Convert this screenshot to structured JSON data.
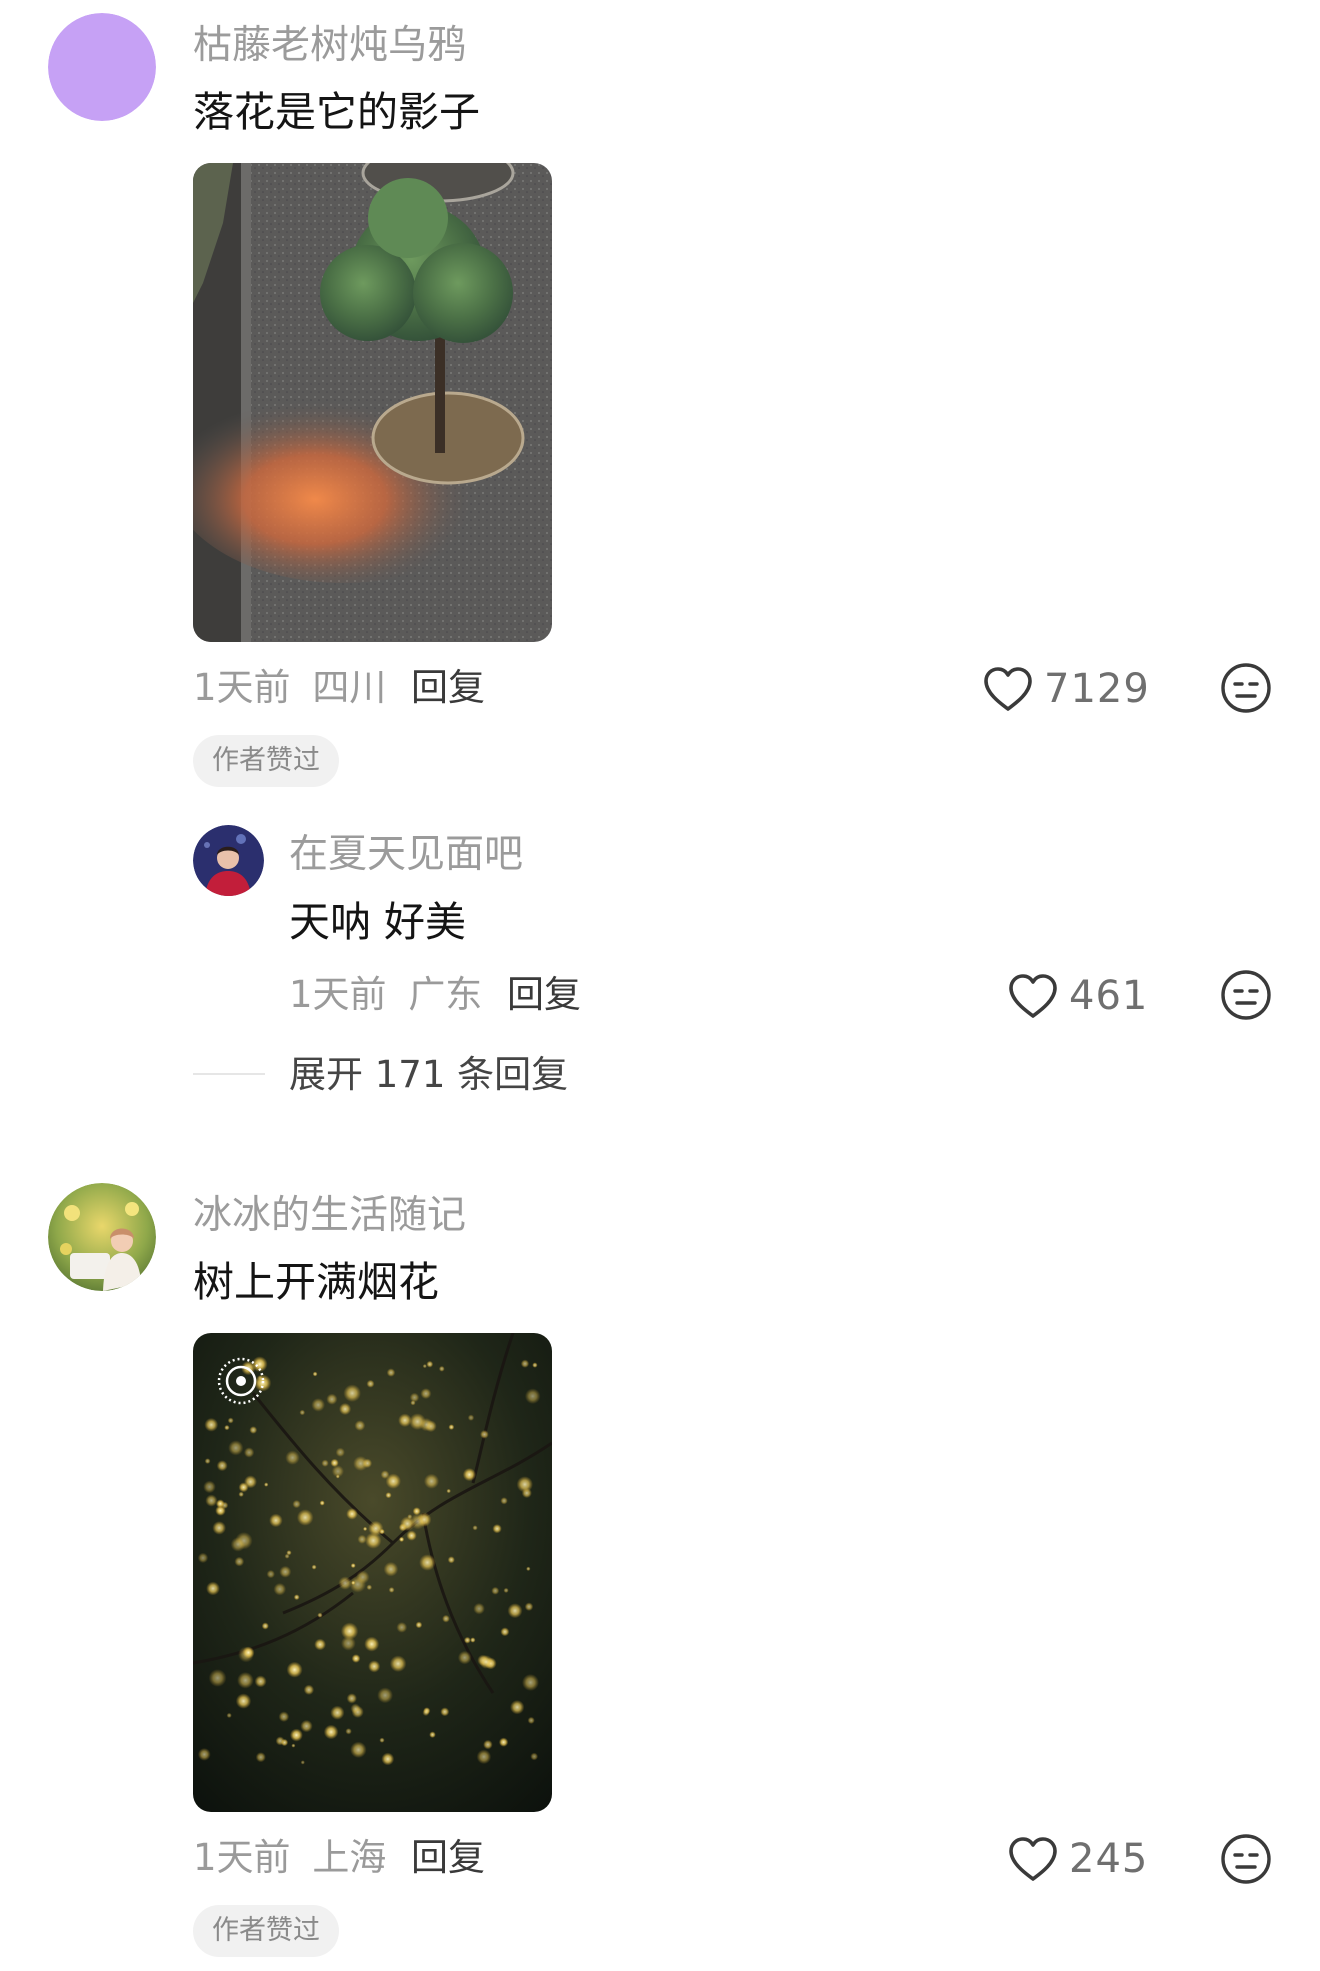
{
  "comments": [
    {
      "username": "枯藤老树炖乌鸦",
      "text": "落花是它的影子",
      "time": "1天前",
      "location": "四川",
      "reply_label": "回复",
      "likes": "7129",
      "badge": "作者赞过",
      "avatar_color": "#c6a1f5",
      "replies": [
        {
          "username": "在夏天见面吧",
          "text": "天呐 好美",
          "time": "1天前",
          "location": "广东",
          "reply_label": "回复",
          "likes": "461"
        }
      ],
      "expand_label": "展开 171 条回复"
    },
    {
      "username": "冰冰的生活随记",
      "text": "树上开满烟花",
      "time": "1天前",
      "location": "上海",
      "reply_label": "回复",
      "likes": "245",
      "badge": "作者赞过"
    }
  ],
  "icons": {
    "like": "heart-outline-icon",
    "emoji": "neutral-face-icon",
    "live_photo": "live-photo-icon"
  }
}
